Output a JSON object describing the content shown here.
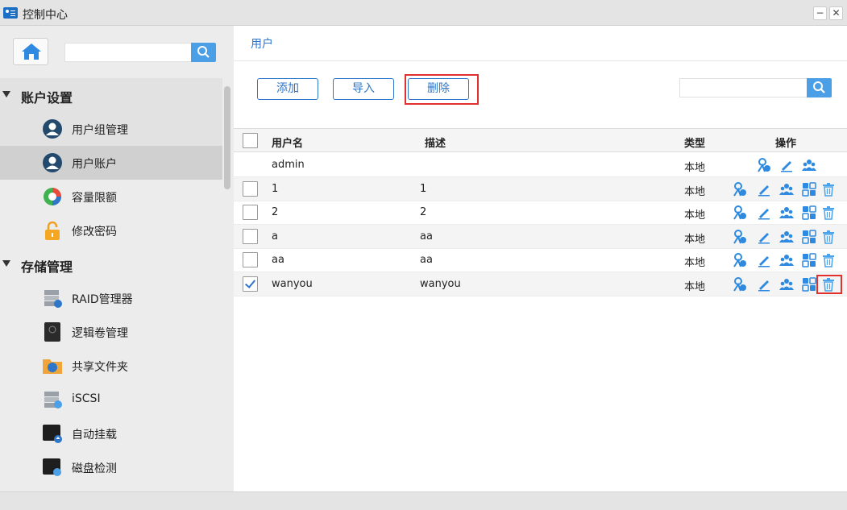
{
  "window": {
    "title": "控制中心",
    "minimize_label": "−",
    "maximize_label": "□",
    "close_label": "✕"
  },
  "sidebar": {
    "search_placeholder": "",
    "sections": [
      {
        "label": "账户设置",
        "items": [
          {
            "label": "用户组管理",
            "icon": "user-group-icon"
          },
          {
            "label": "用户账户",
            "icon": "user-account-icon"
          },
          {
            "label": "容量限额",
            "icon": "quota-pie-icon"
          },
          {
            "label": "修改密码",
            "icon": "padlock-icon"
          }
        ]
      },
      {
        "label": "存储管理",
        "items": [
          {
            "label": "RAID管理器",
            "icon": "raid-server-icon"
          },
          {
            "label": "逻辑卷管理",
            "icon": "logical-volume-icon"
          },
          {
            "label": "共享文件夹",
            "icon": "shared-folder-icon"
          },
          {
            "label": "iSCSI",
            "icon": "iscsi-server-icon"
          },
          {
            "label": "自动挂载",
            "icon": "auto-mount-icon"
          },
          {
            "label": "磁盘检测",
            "icon": "disk-check-icon"
          }
        ]
      }
    ]
  },
  "main": {
    "breadcrumb": "用户",
    "toolbar": {
      "add_label": "添加",
      "import_label": "导入",
      "delete_label": "删除"
    },
    "search_placeholder": "",
    "table": {
      "columns": [
        "用户名",
        "描述",
        "类型",
        "操作"
      ],
      "rows": [
        {
          "username": "admin",
          "description": "",
          "type": "本地",
          "checkbox": false,
          "checked": false
        },
        {
          "username": "1",
          "description": "1",
          "type": "本地",
          "checkbox": true,
          "checked": false
        },
        {
          "username": "2",
          "description": "2",
          "type": "本地",
          "checkbox": true,
          "checked": false
        },
        {
          "username": "a",
          "description": "aa",
          "type": "本地",
          "checkbox": true,
          "checked": false
        },
        {
          "username": "aa",
          "description": "aa",
          "type": "本地",
          "checkbox": true,
          "checked": false
        },
        {
          "username": "wanyou",
          "description": "wanyou",
          "type": "本地",
          "checkbox": true,
          "checked": true
        }
      ],
      "action_icons": [
        "user-permission-icon",
        "edit-pencil-icon",
        "user-group-icon",
        "app-grid-icon",
        "trash-icon"
      ]
    }
  },
  "colors": {
    "accent": "#2d76c9",
    "search_button": "#4a9fe6",
    "highlight": "#e0312f",
    "sidebar_bg": "#ececec"
  }
}
